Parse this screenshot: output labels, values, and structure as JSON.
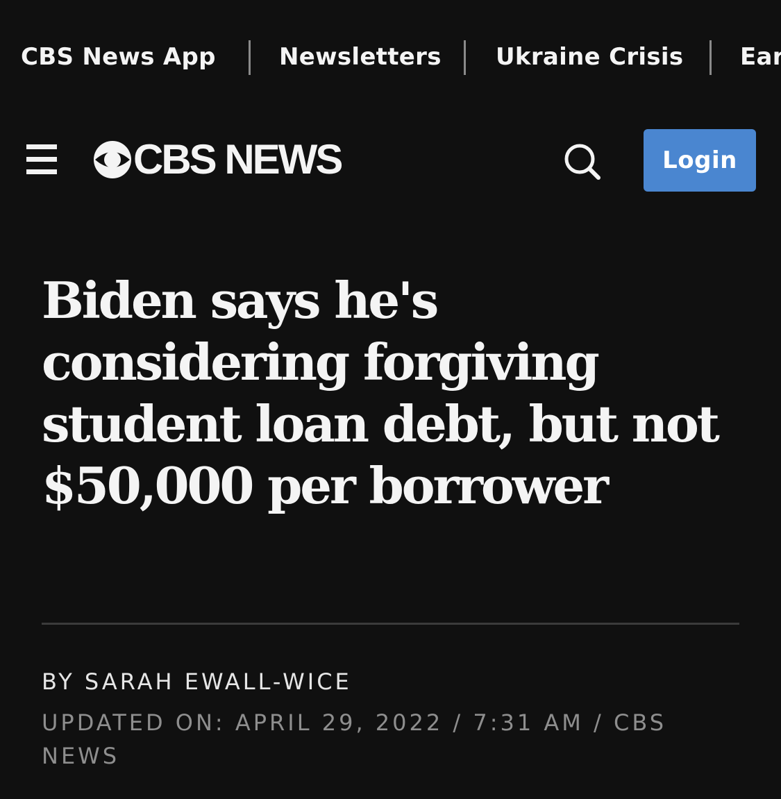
{
  "topnav": {
    "links": [
      {
        "label": "CBS News App"
      },
      {
        "label": "Newsletters"
      },
      {
        "label": "Ukraine Crisis"
      },
      {
        "label": "Ear"
      }
    ]
  },
  "header": {
    "menu_icon": "hamburger-icon",
    "logo_text": "CBS NEWS",
    "logo_icon": "cbs-eye-icon",
    "search_icon": "search-icon",
    "login_label": "Login",
    "login_color": "#4a86d0"
  },
  "article": {
    "headline": "Biden says he's considering forgiving student loan debt, but not $50,000 per borrower",
    "byline": "By Sarah Ewall-Wice",
    "updated": "Updated on: April 29, 2022 / 7:31 AM / CBS News"
  },
  "colors": {
    "background": "#101010",
    "text": "#f4f4f4",
    "muted": "#8e8e8e"
  }
}
